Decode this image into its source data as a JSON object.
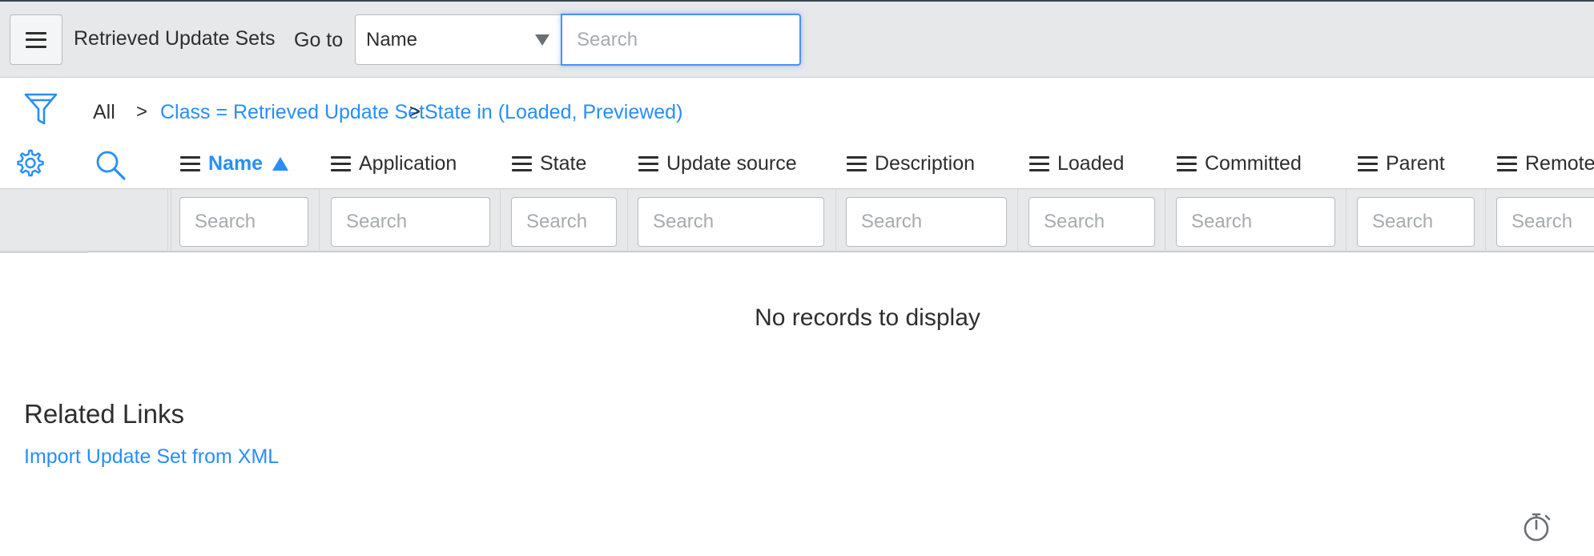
{
  "header": {
    "title": "Retrieved Update Sets",
    "goto_label": "Go to",
    "goto_field": "Name",
    "search_placeholder": "Search"
  },
  "breadcrumb": {
    "root": "All",
    "separator": ">",
    "items": [
      "Class = Retrieved Update Set",
      "State in (Loaded, Previewed)"
    ]
  },
  "columns": [
    {
      "label": "Name",
      "sorted": "ascending",
      "search_placeholder": "Search"
    },
    {
      "label": "Application",
      "search_placeholder": "Search"
    },
    {
      "label": "State",
      "search_placeholder": "Search"
    },
    {
      "label": "Update source",
      "search_placeholder": "Search"
    },
    {
      "label": "Description",
      "search_placeholder": "Search"
    },
    {
      "label": "Loaded",
      "search_placeholder": "Search"
    },
    {
      "label": "Committed",
      "search_placeholder": "Search"
    },
    {
      "label": "Parent",
      "search_placeholder": "Search"
    },
    {
      "label": "Remote",
      "search_placeholder": "Search"
    }
  ],
  "list": {
    "empty_message": "No records to display"
  },
  "related_links": {
    "heading": "Related Links",
    "items": [
      "Import Update Set from XML"
    ]
  },
  "colors": {
    "link": "#278efc",
    "header_bg": "#e6e8ea",
    "focus": "#4c8ffb"
  },
  "icons": [
    "menu-icon",
    "filter-icon",
    "gear-icon",
    "search-icon",
    "sort-ascending-icon",
    "column-menu-icon",
    "timer-icon"
  ]
}
